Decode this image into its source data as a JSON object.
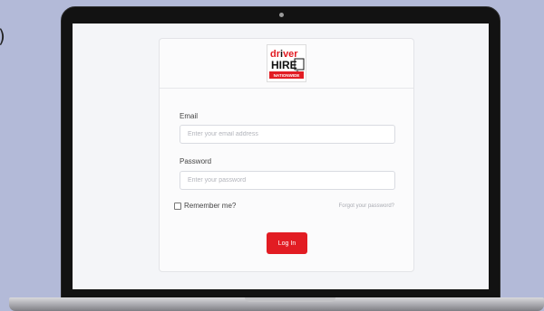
{
  "edge_glyph": ")",
  "logo": {
    "word1": "dr",
    "word1_ver": "ver",
    "word2": "HIRE",
    "tagline": "NATIONWIDE"
  },
  "login_form": {
    "email_label": "Email",
    "email_placeholder": "Enter your email address",
    "email_value": "",
    "password_label": "Password",
    "password_placeholder": "Enter your password",
    "password_value": "",
    "remember_label": "Remember me?",
    "remember_checked": false,
    "forgot_label": "Forgot your password?",
    "login_label": "Log In"
  },
  "colors": {
    "page_background": "#b3bad8",
    "screen_background": "#f4f5f8",
    "brand_red": "#e21c23",
    "lid": "#121212"
  }
}
